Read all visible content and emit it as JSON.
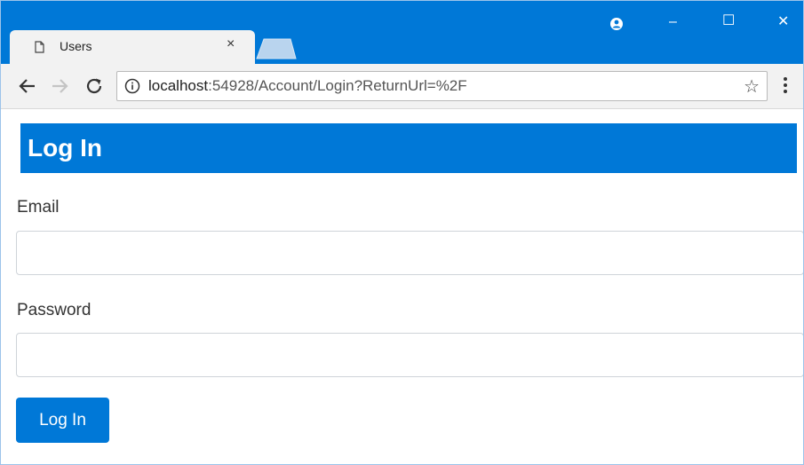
{
  "browser": {
    "tab_title": "Users",
    "tab_close": "×",
    "url_host": "localhost",
    "url_rest": ":54928/Account/Login?ReturnUrl=%2F",
    "accent_color": "#0078d7",
    "window_controls": {
      "minimize": "–",
      "maximize": "☐",
      "close": "✕"
    },
    "icons": [
      "page-icon",
      "profile-icon",
      "back-icon",
      "forward-icon",
      "reload-icon",
      "info-icon",
      "star-icon",
      "menu-icon"
    ]
  },
  "page": {
    "heading": "Log In",
    "email_label": "Email",
    "email_value": "",
    "password_label": "Password",
    "password_value": "",
    "submit_label": "Log In"
  }
}
